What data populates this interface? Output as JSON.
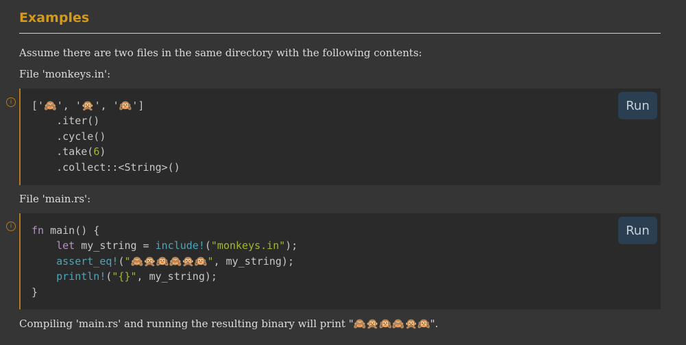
{
  "heading": "Examples",
  "intro": "Assume there are two files in the same directory with the following contents:",
  "file1_label": "File 'monkeys.in':",
  "file2_label": "File 'main.rs':",
  "outro_prefix": "Compiling 'main.rs' and running the resulting binary will print \"",
  "outro_emoji": "🙈🙊🙉🙈🙊🙉",
  "outro_suffix": "\".",
  "run_label": "Run",
  "info_icon": "info-icon",
  "code1": {
    "line1_open": "['",
    "emoji1": "🙈",
    "sep1": "', '",
    "emoji2": "🙊",
    "sep2": "', '",
    "emoji3": "🙉",
    "line1_close": "']",
    "line2": "    .iter()",
    "line3": "    .cycle()",
    "line4_a": "    .take(",
    "line4_num": "6",
    "line4_b": ")",
    "line5": "    .collect::<String>()"
  },
  "code2": {
    "fn_kw": "fn",
    "fn_rest": " main() {",
    "let_kw": "let",
    "let_rest": " my_string = ",
    "include_macro": "include!",
    "include_open": "(",
    "include_str": "\"monkeys.in\"",
    "include_close": ");",
    "assert_macro": "assert_eq!",
    "assert_open": "(",
    "assert_str": "\"🙈🙊🙉🙈🙊🙉\"",
    "assert_rest": ", my_string);",
    "println_macro": "println!",
    "println_open": "(",
    "println_str": "\"{}\"",
    "println_rest": ", my_string);",
    "close": "}"
  },
  "colors": {
    "heading": "#d2991d",
    "background": "#353535",
    "code_bg": "#2a2a2a",
    "accent_border": "#b57a1f",
    "keyword": "#b294bb",
    "macro": "#4ea5b8",
    "string": "#a2b829",
    "run_button": "#2b3f52"
  }
}
